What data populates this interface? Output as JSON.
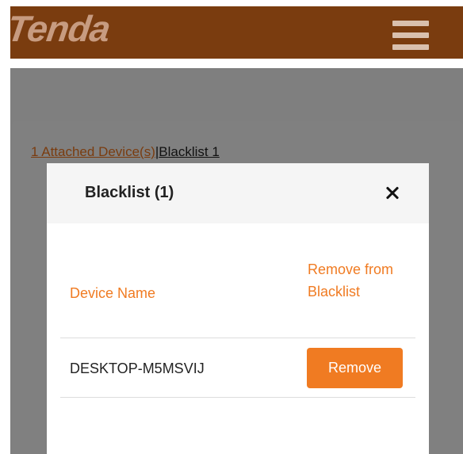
{
  "header": {
    "logo_text": "Tenda",
    "menu_icon": "hamburger-menu-icon",
    "background_color": "#7a3c0f"
  },
  "devices_nav": {
    "attached_label": "1 Attached Device(s)",
    "separator": "|",
    "blacklist_label": "Blacklist 1"
  },
  "modal": {
    "title": "Blacklist (1)",
    "close_icon": "close-icon",
    "columns": {
      "device_name": "Device Name",
      "remove_from_blacklist": "Remove from Blacklist"
    },
    "rows": [
      {
        "device_name": "DESKTOP-M5MSVIJ",
        "action_label": "Remove"
      }
    ]
  },
  "colors": {
    "accent": "#f07b22",
    "overlay": "#7f7f7f"
  }
}
